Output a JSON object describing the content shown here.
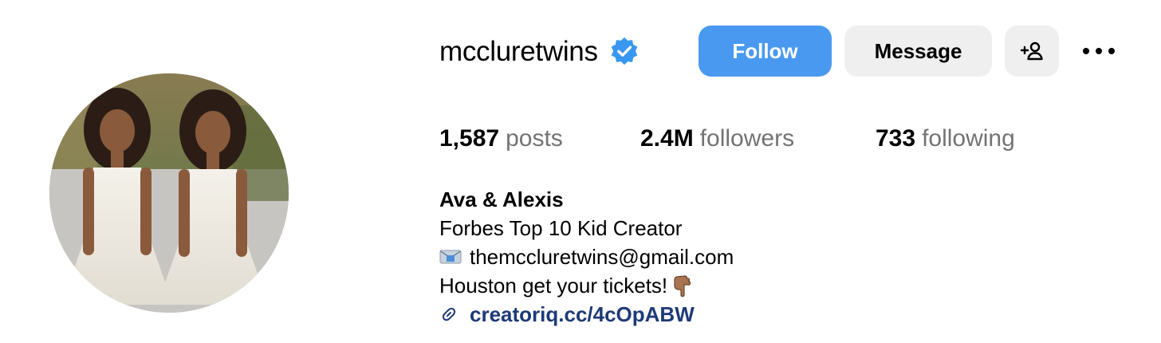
{
  "profile": {
    "username": "mccluretwins",
    "verified": true,
    "stats": [
      {
        "value": "1,587",
        "label": "posts"
      },
      {
        "value": "2.4M",
        "label": "followers"
      },
      {
        "value": "733",
        "label": "following"
      }
    ],
    "bio": {
      "name": "Ava & Alexis",
      "line1": "Forbes Top 10 Kid Creator",
      "email": "themccluretwins@gmail.com",
      "line3": "Houston get your tickets!",
      "link": "creatoriq.cc/4cOpABW"
    }
  },
  "actions": {
    "follow": "Follow",
    "message": "Message"
  },
  "icons": {
    "verified": "verified-badge-icon",
    "add_user": "add-user-icon",
    "more": "more-options-icon",
    "email": "envelope-icon",
    "hand": "pointing-down-emoji-icon",
    "link": "link-icon"
  },
  "colors": {
    "follow_button": "#4a99f0",
    "secondary_button": "#efefef",
    "link": "#1d3a78",
    "muted_text": "#737373",
    "verified_badge": "#3897f0"
  }
}
